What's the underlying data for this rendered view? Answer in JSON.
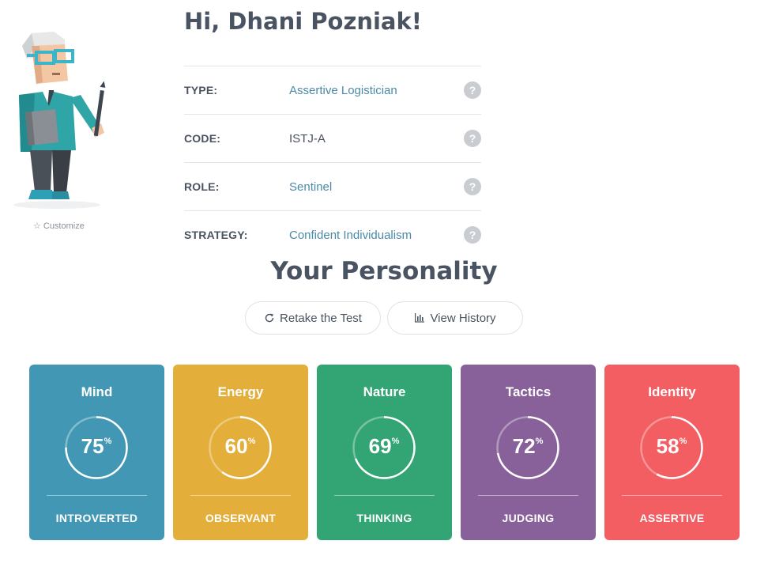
{
  "header": {
    "greeting": "Hi, Dhani Pozniak!"
  },
  "avatar": {
    "customize_label": "Customize",
    "customize_icon": "star-outline-icon"
  },
  "profile": {
    "rows": [
      {
        "label": "TYPE:",
        "value": "Assertive Logistician",
        "help_icon": "?"
      },
      {
        "label": "CODE:",
        "value": "ISTJ-A",
        "help_icon": "?"
      },
      {
        "label": "ROLE:",
        "value": "Sentinel",
        "help_icon": "?"
      },
      {
        "label": "STRATEGY:",
        "value": "Confident Individualism",
        "help_icon": "?"
      }
    ]
  },
  "personality": {
    "title": "Your Personality",
    "retake_label": "Retake the Test",
    "history_label": "View History",
    "cards": [
      {
        "title": "Mind",
        "percent": 75,
        "percent_text": "75",
        "trait": "INTROVERTED",
        "color": "#4298b4"
      },
      {
        "title": "Energy",
        "percent": 60,
        "percent_text": "60",
        "trait": "OBSERVANT",
        "color": "#e4ae3a"
      },
      {
        "title": "Nature",
        "percent": 69,
        "percent_text": "69",
        "trait": "THINKING",
        "color": "#33a474"
      },
      {
        "title": "Tactics",
        "percent": 72,
        "percent_text": "72",
        "trait": "JUDGING",
        "color": "#88619a"
      },
      {
        "title": "Identity",
        "percent": 58,
        "percent_text": "58",
        "trait": "ASSERTIVE",
        "color": "#f25e62"
      }
    ],
    "percent_sign": "%"
  },
  "colors": {
    "link": "#4a8aa8",
    "text": "#4a5361"
  }
}
